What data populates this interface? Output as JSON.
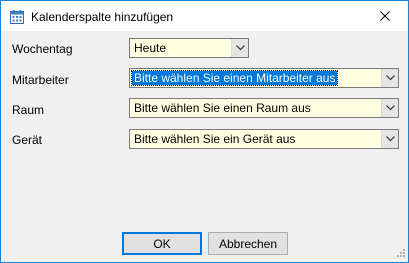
{
  "window": {
    "title": "Kalenderspalte hinzufügen"
  },
  "form": {
    "weekday": {
      "label": "Wochentag",
      "value": "Heute"
    },
    "employee": {
      "label": "Mitarbeiter",
      "value": "Bitte wählen Sie einen Mitarbeiter aus"
    },
    "room": {
      "label": "Raum",
      "value": "Bitte wählen Sie einen Raum aus"
    },
    "device": {
      "label": "Gerät",
      "value": "Bitte wählen Sie ein Gerät aus"
    }
  },
  "buttons": {
    "ok": "OK",
    "cancel": "Abbrechen"
  },
  "colors": {
    "field_background": "#ffffe1",
    "selection": "#0078d7",
    "window_border": "#1883d7"
  }
}
